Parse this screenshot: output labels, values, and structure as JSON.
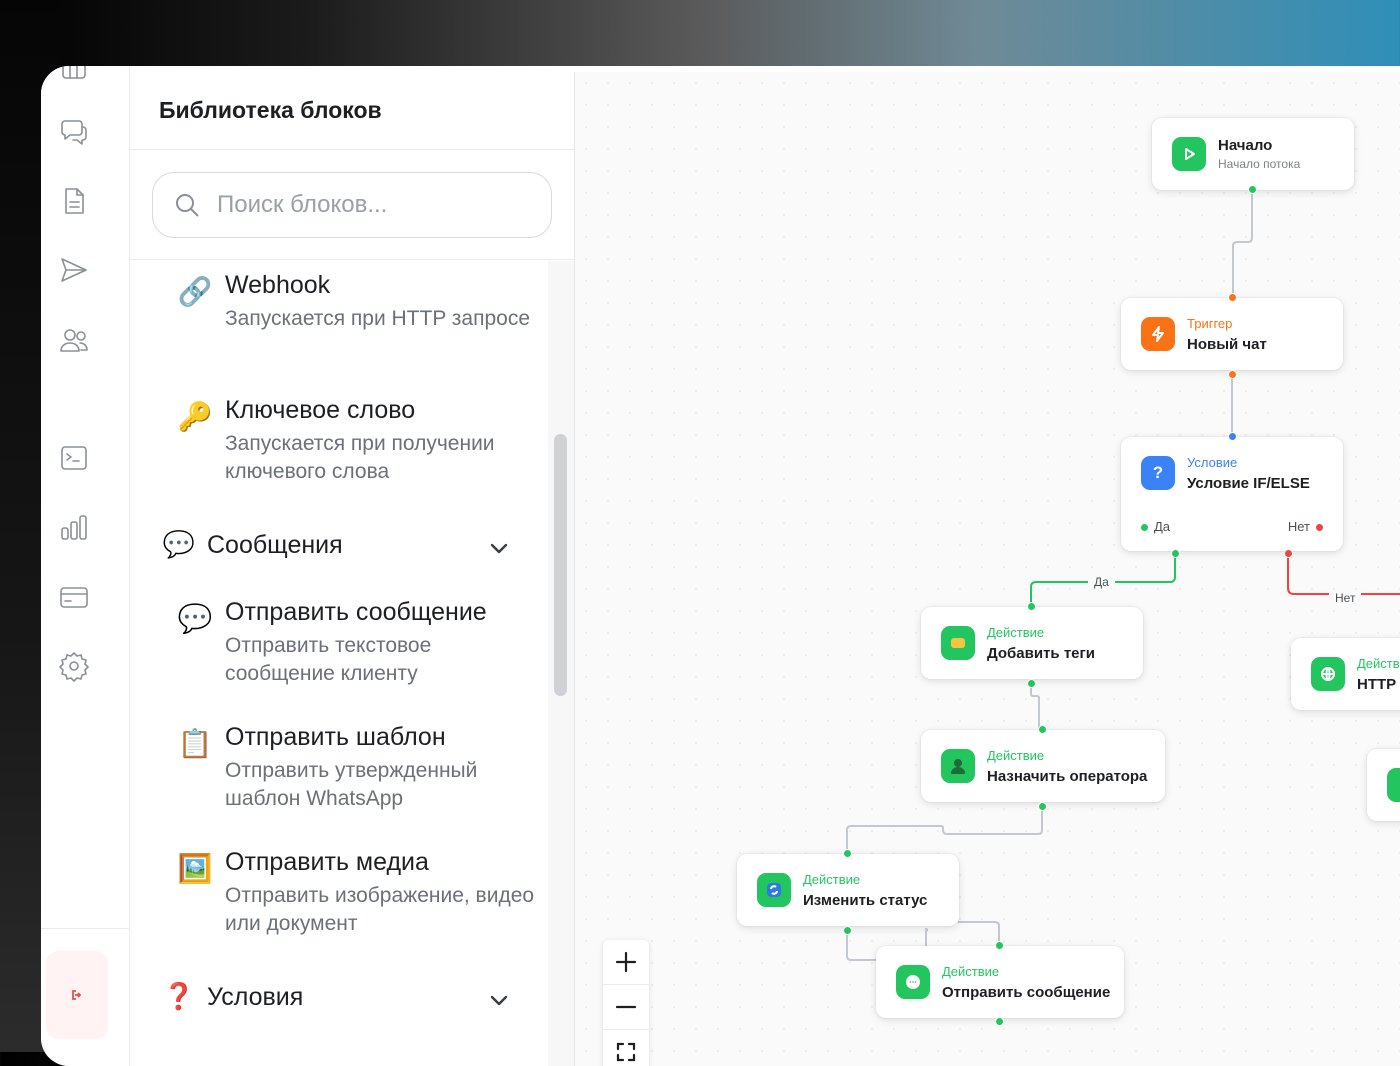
{
  "library": {
    "title": "Библиотека блоков",
    "search_placeholder": "Поиск блоков...",
    "items": [
      {
        "emoji": "🔗",
        "title": "Webhook",
        "desc": "Запускается при HTTP запросе"
      },
      {
        "emoji": "🔑",
        "title": "Ключевое слово",
        "desc": "Запускается при получении ключевого слова"
      },
      {
        "emoji": "💬",
        "title": "Отправить сообщение",
        "desc": "Отправить текстовое сообщение клиенту"
      },
      {
        "emoji": "📋",
        "title": "Отправить шаблон",
        "desc": "Отправить утвержденный шаблон WhatsApp"
      },
      {
        "emoji": "🖼️",
        "title": "Отправить медиа",
        "desc": "Отправить изображение, видео или документ"
      }
    ],
    "categories": [
      {
        "emoji": "💬",
        "label": "Сообщения"
      },
      {
        "emoji": "❓",
        "label": "Условия"
      }
    ]
  },
  "flow": {
    "start": {
      "title": "Начало",
      "subtitle": "Начало потока"
    },
    "trigger": {
      "type": "Триггер",
      "title": "Новый чат"
    },
    "condition": {
      "type": "Условие",
      "title": "Условие IF/ELSE",
      "yes": "Да",
      "no": "Нет"
    },
    "add_tags": {
      "type": "Действие",
      "title": "Добавить теги"
    },
    "assign_operator": {
      "type": "Действие",
      "title": "Назначить оператора"
    },
    "change_status": {
      "type": "Действие",
      "title": "Изменить статус"
    },
    "send_message": {
      "type": "Действие",
      "title": "Отправить сообщение"
    },
    "http": {
      "type": "Действие",
      "title": "HTTP"
    },
    "edge_yes": "Да",
    "edge_no": "Нет"
  },
  "colors": {
    "green": "#22c55e",
    "orange": "#f97316",
    "blue": "#3b82f6",
    "red": "#ef4444",
    "edge_gray": "#c3c8d0"
  }
}
